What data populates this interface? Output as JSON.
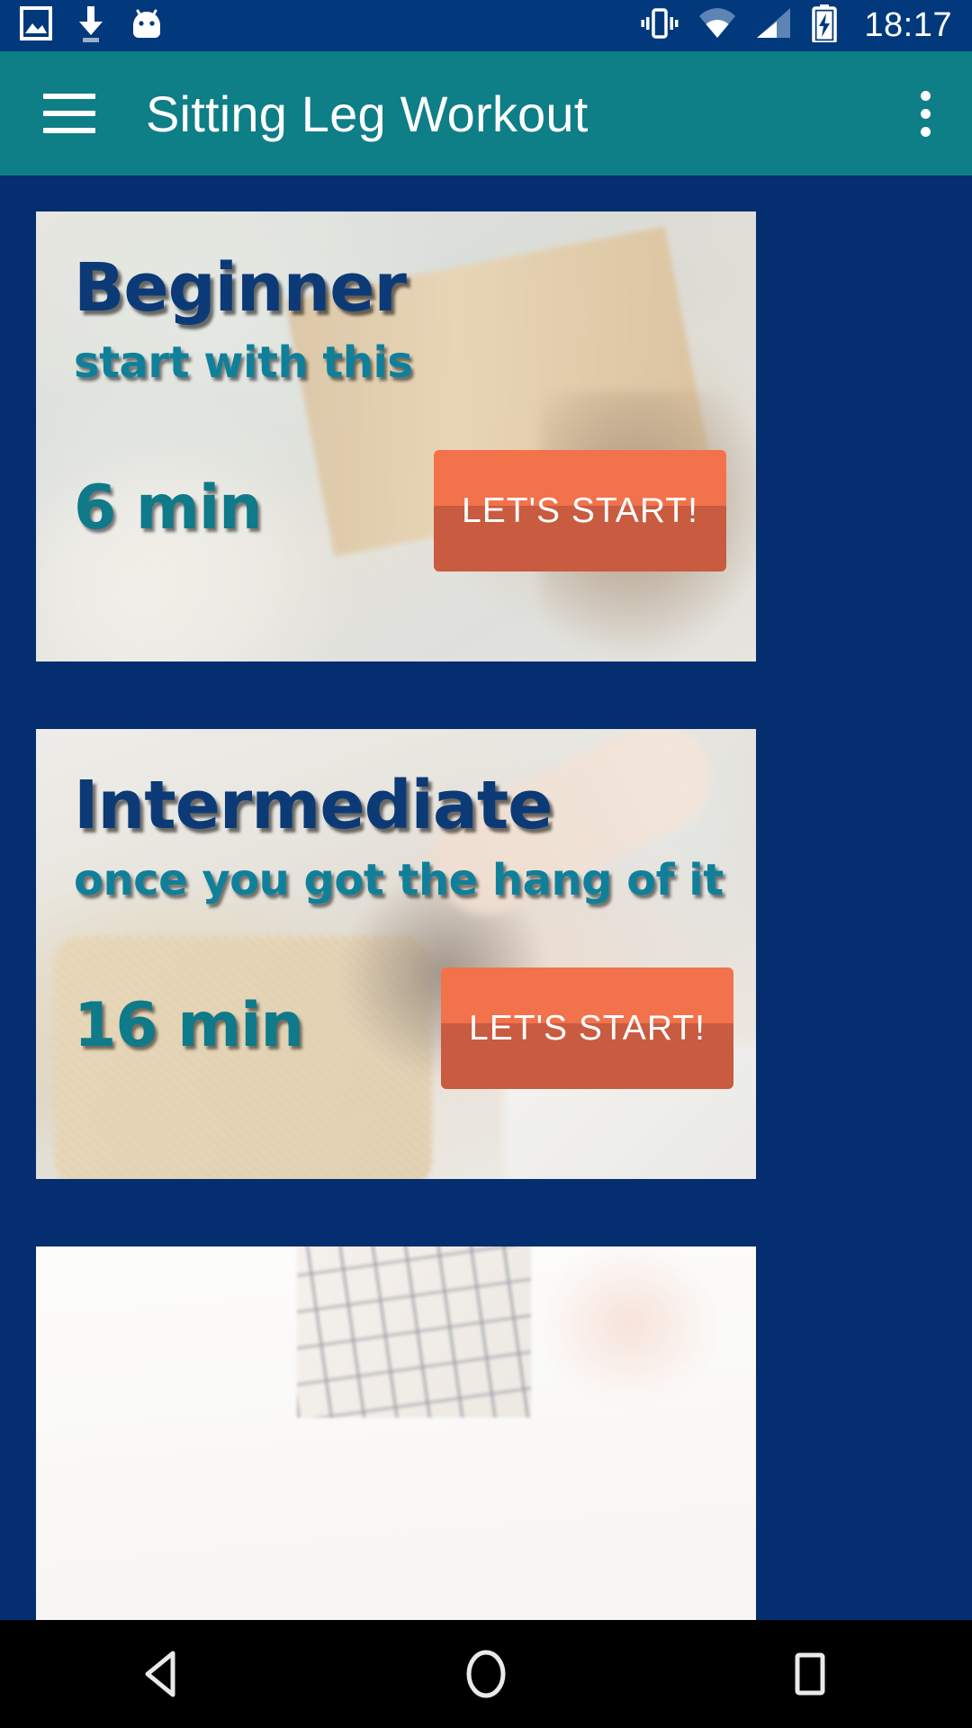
{
  "status_bar": {
    "time": "18:17",
    "left_icons": [
      {
        "name": "screenshot-image-icon",
        "glyph": "image"
      },
      {
        "name": "download-icon",
        "glyph": "download-arrow"
      },
      {
        "name": "android-system-icon",
        "glyph": "bugdroid"
      }
    ],
    "right_icons": [
      {
        "name": "vibrate-mode-icon",
        "glyph": "vibrate"
      },
      {
        "name": "wifi-icon",
        "glyph": "wifi"
      },
      {
        "name": "cellular-signal-icon",
        "glyph": "signal"
      },
      {
        "name": "battery-charging-icon",
        "glyph": "battery-bolt"
      }
    ],
    "background_color": "#01397C"
  },
  "toolbar": {
    "title": "Sitting Leg Workout",
    "menu_icon": "hamburger-menu-icon",
    "overflow_icon": "overflow-menu-icon",
    "background_color": "#0E7E87",
    "text_color": "#FFFFFF"
  },
  "theme": {
    "page_background": "#042E6F",
    "card_title_color": "#0B3A77",
    "card_subtitle_color": "#10809A",
    "duration_color": "#0E7A8A",
    "button_top_color": "#F2724C",
    "button_bottom_color": "#C85B40",
    "button_text_color": "#FFFFFF"
  },
  "workouts": [
    {
      "title": "Beginner",
      "subtitle": "start with this",
      "duration": "6 min",
      "button_label": "LET'S START!"
    },
    {
      "title": "Intermediate",
      "subtitle": "once you got the hang of it",
      "duration": "16 min",
      "button_label": "LET'S START!"
    },
    {
      "title": "",
      "subtitle": "",
      "duration": "",
      "button_label": ""
    }
  ],
  "nav_bar": {
    "back_label": "back-button",
    "home_label": "home-button",
    "recents_label": "recents-button",
    "background_color": "#000000"
  }
}
